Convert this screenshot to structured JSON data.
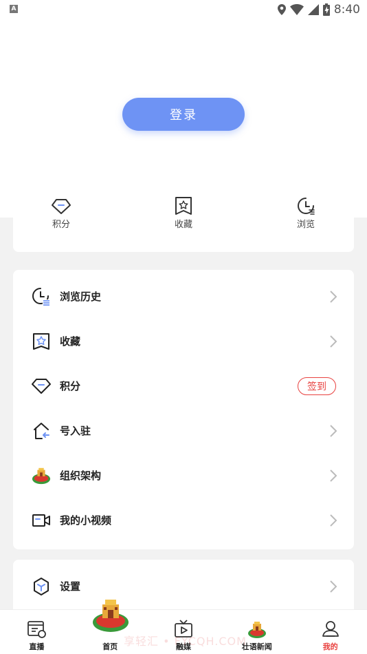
{
  "status_bar": {
    "time": "8:40",
    "indicator": "A"
  },
  "login_button": "登录",
  "quick_links": [
    {
      "label": "积分",
      "icon": "diamond-icon"
    },
    {
      "label": "收藏",
      "icon": "star-bookmark-icon"
    },
    {
      "label": "浏览",
      "icon": "clock-icon"
    }
  ],
  "menu": [
    {
      "label": "浏览历史",
      "icon": "history-clock-icon"
    },
    {
      "label": "收藏",
      "icon": "star-bookmark-icon"
    },
    {
      "label": "积分",
      "icon": "diamond-icon",
      "badge": "签到"
    },
    {
      "label": "号入驻",
      "icon": "house-arrow-icon"
    },
    {
      "label": "组织架构",
      "icon": "logo-emblem-icon"
    },
    {
      "label": "我的小视频",
      "icon": "video-camera-icon"
    }
  ],
  "settings": {
    "label": "设置",
    "icon": "settings-cube-icon"
  },
  "tabs": [
    {
      "label": "直播",
      "icon": "live-icon"
    },
    {
      "label": "首页",
      "icon": "home-emblem-icon"
    },
    {
      "label": "融媒",
      "icon": "tv-icon"
    },
    {
      "label": "壮语新闻",
      "icon": "news-emblem-icon"
    },
    {
      "label": "我的",
      "icon": "profile-icon",
      "active": true
    }
  ],
  "watermark": "享轻汇 • FYCQH.COM",
  "colors": {
    "accent": "#6e93f4",
    "active": "#e8413f",
    "background": "#f2f2f2"
  }
}
